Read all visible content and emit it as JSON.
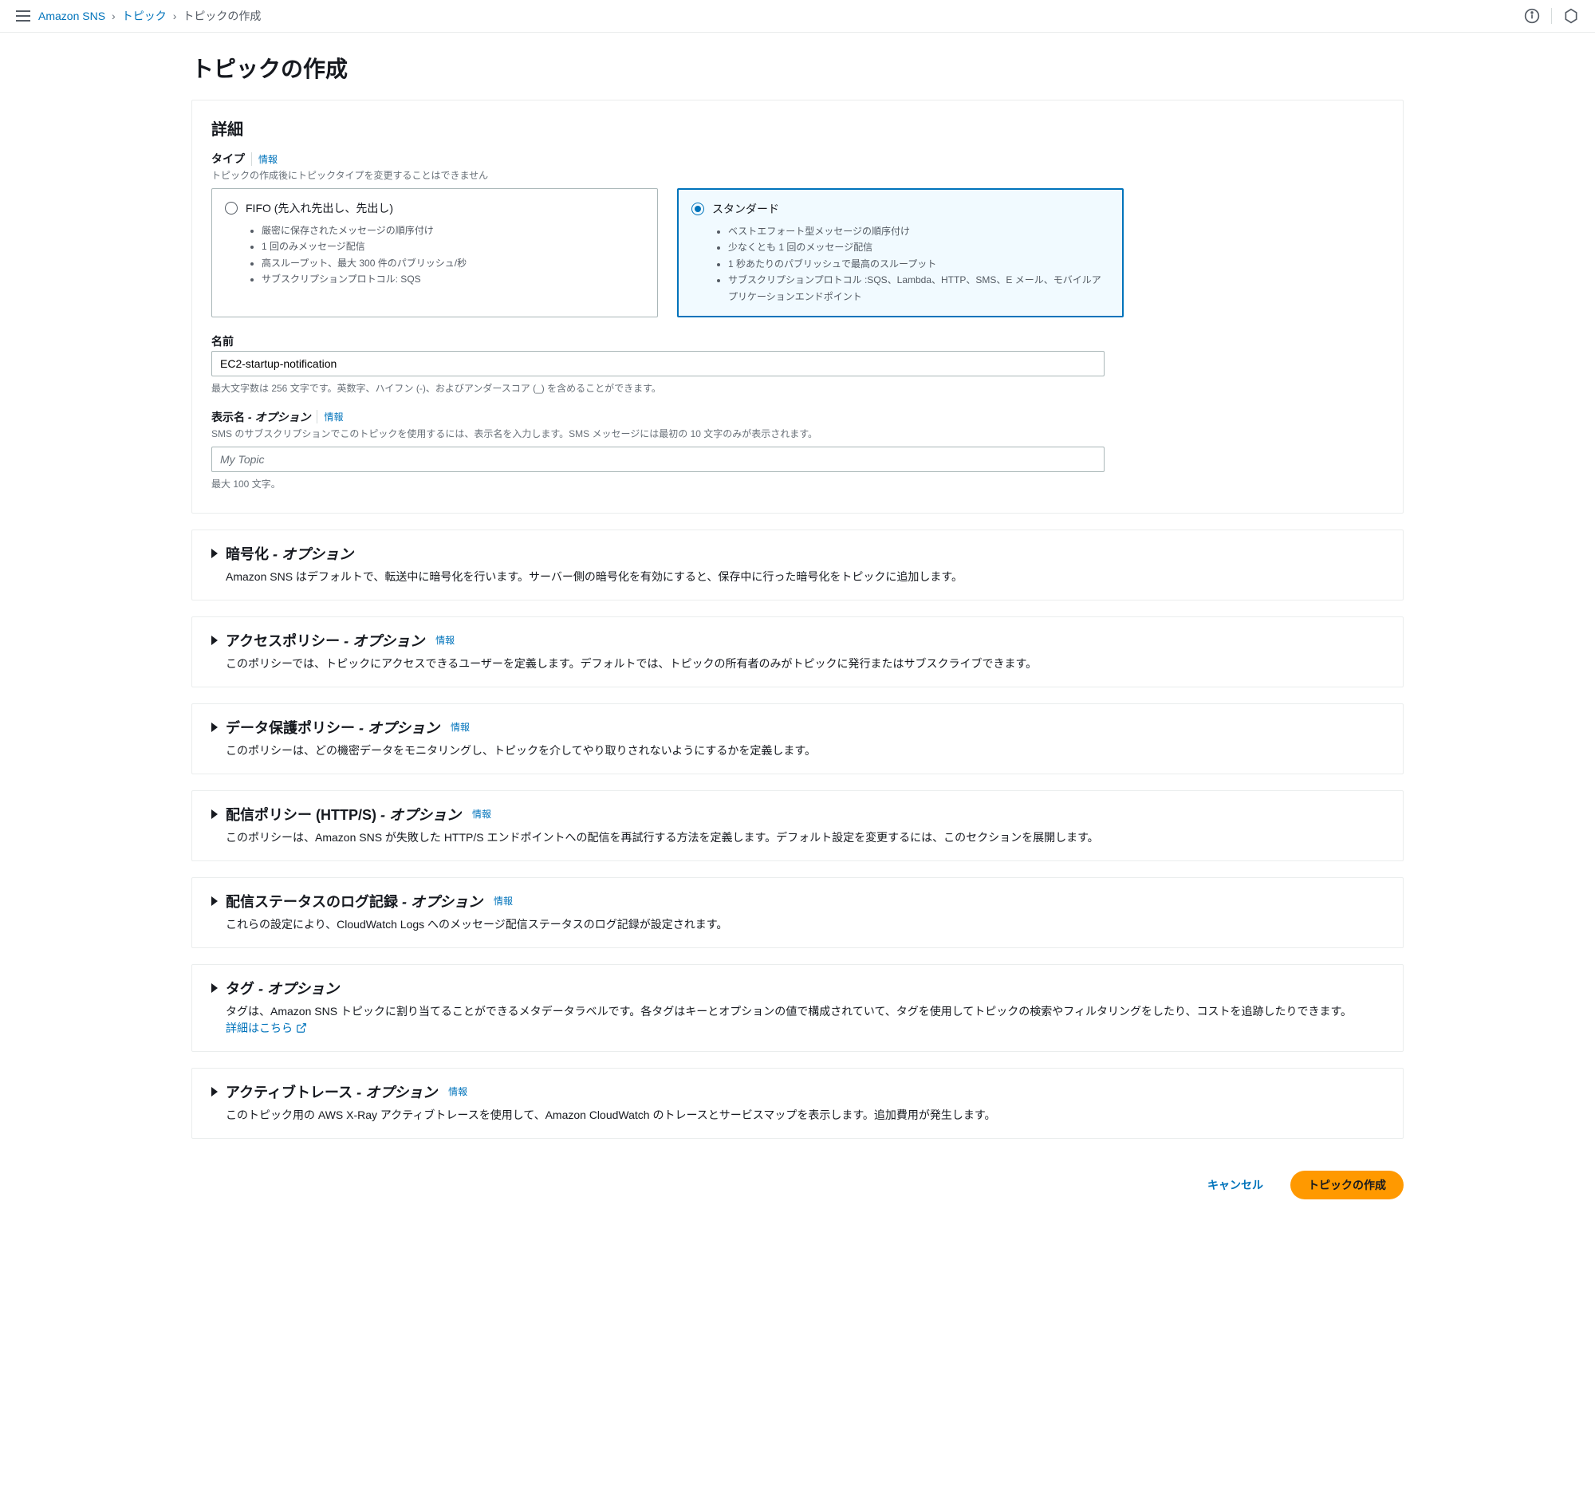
{
  "breadcrumb": {
    "service": "Amazon SNS",
    "topics": "トピック",
    "current": "トピックの作成"
  },
  "page_title": "トピックの作成",
  "detail": {
    "header": "詳細",
    "type_label": "タイプ",
    "type_info": "情報",
    "type_hint": "トピックの作成後にトピックタイプを変更することはできません",
    "fifo": {
      "title": "FIFO (先入れ先出し、先出し)",
      "b1": "厳密に保存されたメッセージの順序付け",
      "b2": "1 回のみメッセージ配信",
      "b3": "高スループット、最大 300 件のパブリッシュ/秒",
      "b4": "サブスクリプションプロトコル: SQS"
    },
    "standard": {
      "title": "スタンダード",
      "b1": "ベストエフォート型メッセージの順序付け",
      "b2": "少なくとも 1 回のメッセージ配信",
      "b3": "1 秒あたりのパブリッシュで最高のスループット",
      "b4": "サブスクリプションプロトコル :SQS、Lambda、HTTP、SMS、E メール、モバイルアプリケーションエンドポイント"
    },
    "name_label": "名前",
    "name_value": "EC2-startup-notification",
    "name_hint": "最大文字数は 256 文字です。英数字、ハイフン (-)、およびアンダースコア (_) を含めることができます。",
    "display_label": "表示名",
    "display_optional": "- オプション",
    "display_info": "情報",
    "display_hint": "SMS のサブスクリプションでこのトピックを使用するには、表示名を入力します。SMS メッセージには最初の 10 文字のみが表示されます。",
    "display_placeholder": "My Topic",
    "display_hint2": "最大 100 文字。"
  },
  "sections": {
    "encryption": {
      "title": "暗号化",
      "opt": " - オプション",
      "desc": "Amazon SNS はデフォルトで、転送中に暗号化を行います。サーバー側の暗号化を有効にすると、保存中に行った暗号化をトピックに追加します。"
    },
    "access": {
      "title": "アクセスポリシー",
      "opt": " - オプション",
      "info": "情報",
      "desc": "このポリシーでは、トピックにアクセスできるユーザーを定義します。デフォルトでは、トピックの所有者のみがトピックに発行またはサブスクライブできます。"
    },
    "data_protection": {
      "title": "データ保護ポリシー",
      "opt": " - オプション",
      "info": "情報",
      "desc": "このポリシーは、どの機密データをモニタリングし、トピックを介してやり取りされないようにするかを定義します。"
    },
    "delivery": {
      "title": "配信ポリシー (HTTP/S)",
      "opt": " - オプション",
      "info": "情報",
      "desc": "このポリシーは、Amazon SNS が失敗した HTTP/S エンドポイントへの配信を再試行する方法を定義します。デフォルト設定を変更するには、このセクションを展開します。"
    },
    "logging": {
      "title": "配信ステータスのログ記録",
      "opt": " - オプション",
      "info": "情報",
      "desc": "これらの設定により、CloudWatch Logs へのメッセージ配信ステータスのログ記録が設定されます。"
    },
    "tags": {
      "title": "タグ",
      "opt": " - オプション",
      "desc": "タグは、Amazon SNS トピックに割り当てることができるメタデータラベルです。各タグはキーとオプションの値で構成されていて、タグを使用してトピックの検索やフィルタリングをしたり、コストを追跡したりできます。 ",
      "link": "詳細はこちら"
    },
    "tracing": {
      "title": "アクティブトレース",
      "opt": " - オプション",
      "info": "情報",
      "desc": "このトピック用の AWS X-Ray アクティブトレースを使用して、Amazon CloudWatch のトレースとサービスマップを表示します。追加費用が発生します。"
    }
  },
  "footer": {
    "cancel": "キャンセル",
    "submit": "トピックの作成"
  }
}
